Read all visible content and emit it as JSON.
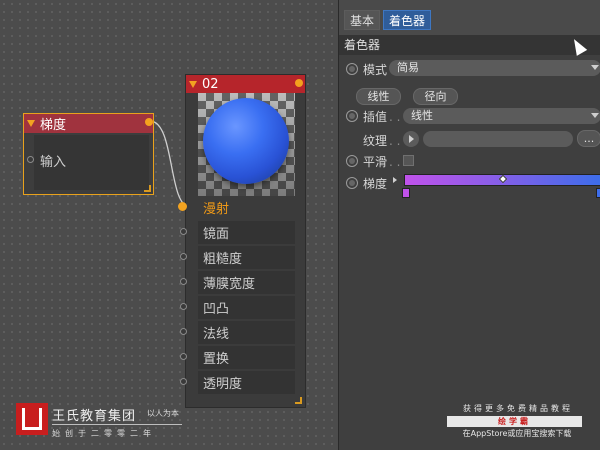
{
  "nodes": {
    "gradient": {
      "title": "梯度",
      "input_label": "输入"
    },
    "material": {
      "title": "02",
      "channels": [
        {
          "label": "漫射",
          "active": true
        },
        {
          "label": "镜面",
          "active": false
        },
        {
          "label": "粗糙度",
          "active": false
        },
        {
          "label": "薄膜宽度",
          "active": false
        },
        {
          "label": "凹凸",
          "active": false
        },
        {
          "label": "法线",
          "active": false
        },
        {
          "label": "置换",
          "active": false
        },
        {
          "label": "透明度",
          "active": false
        }
      ]
    }
  },
  "panel": {
    "tabs": [
      "基本",
      "着色器"
    ],
    "section_title": "着色器",
    "mode_label": "模式",
    "mode_value": "简易",
    "btn_linear": "线性",
    "btn_radial": "径向",
    "interp_label": "插值",
    "interp_value": "线性",
    "texture_label": "纹理",
    "texture_more": "...",
    "smooth_label": "平滑",
    "gradient_label": "梯度",
    "gradient_colors": [
      "#c052ea",
      "#3d6dea"
    ]
  },
  "watermark": {
    "company": "王氏教育集团",
    "slogan": "以人为本",
    "since": "始创于二零零二年",
    "promo_line1": "获得更多免费精品教程",
    "promo_badge": "绘学霸",
    "promo_line3": "在AppStore或应用宝搜索下载"
  },
  "colors": {
    "accent_orange": "#f2a321",
    "node_header_red": "#b6252b",
    "tab_selected": "#2f5d9a"
  }
}
